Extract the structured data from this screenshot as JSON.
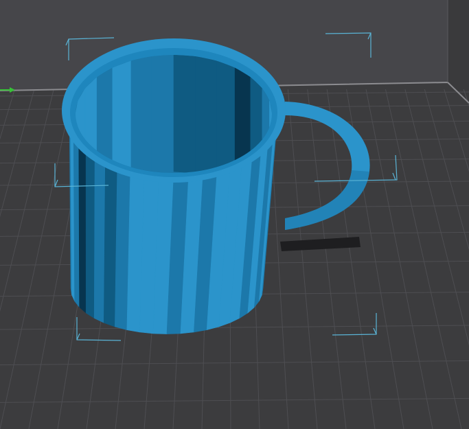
{
  "viewport": {
    "scene": "3d-print-preview",
    "object": "mug",
    "selected": true
  },
  "colors": {
    "back_wall": "#46464a",
    "floor": "#3c3c3e",
    "floor_edge": "#8c8c90",
    "grid_line": "#4e4e52",
    "selection_bracket": "#5ab4d6",
    "axis_x": "#38c038",
    "model_light": "#2b94cb",
    "model_mid": "#1c78aa",
    "model_dark": "#0f5b82",
    "model_shadow": "#07354f",
    "drop_shadow": "#1e1e20"
  },
  "icons": {
    "axis_indicator": "x-axis-arrow-icon",
    "selection_corner": "selection-bracket-icon"
  }
}
